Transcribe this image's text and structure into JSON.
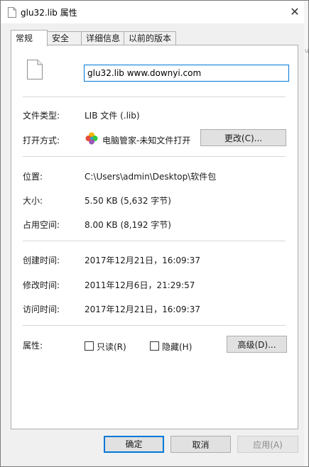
{
  "window": {
    "title": "glu32.lib 属性",
    "close_glyph": "✕"
  },
  "side_fragment": "ug",
  "tabs": [
    {
      "label": "常规"
    },
    {
      "label": "安全"
    },
    {
      "label": "详细信息"
    },
    {
      "label": "以前的版本"
    }
  ],
  "general": {
    "file_name": "glu32.lib www.downyi.com",
    "type": {
      "label": "文件类型:",
      "value": "LIB 文件 (.lib)"
    },
    "opens_with": {
      "label": "打开方式:",
      "value": "电脑管家-未知文件打开",
      "change_button": "更改(C)..."
    },
    "location": {
      "label": "位置:",
      "value": "C:\\Users\\admin\\Desktop\\软件包"
    },
    "size": {
      "label": "大小:",
      "value": "5.50 KB (5,632 字节)"
    },
    "size_on_disk": {
      "label": "占用空间:",
      "value": "8.00 KB (8,192 字节)"
    },
    "created": {
      "label": "创建时间:",
      "value": "2017年12月21日，16:09:37"
    },
    "modified": {
      "label": "修改时间:",
      "value": "2011年12月6日，21:29:57"
    },
    "accessed": {
      "label": "访问时间:",
      "value": "2017年12月21日，16:09:37"
    },
    "attributes": {
      "label": "属性:",
      "readonly": {
        "label": "只读(R)",
        "checked": false
      },
      "hidden": {
        "label": "隐藏(H)",
        "checked": false
      },
      "advanced_button": "高级(D)..."
    }
  },
  "footer": {
    "ok": "确定",
    "cancel": "取消",
    "apply": "应用(A)"
  },
  "colors": {
    "accent": "#0078d7",
    "panel_bg": "#ffffff",
    "window_bg": "#f0f0f0",
    "separator": "#d6d6d6"
  }
}
